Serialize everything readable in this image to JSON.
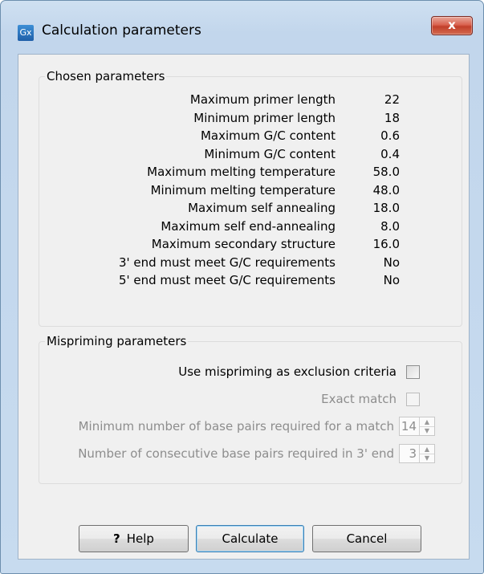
{
  "window": {
    "title": "Calculation parameters",
    "app_icon": "Gx",
    "close_glyph": "x"
  },
  "chosen": {
    "group_label": "Chosen parameters",
    "rows": [
      {
        "label": "Maximum primer length",
        "value": "22"
      },
      {
        "label": "Minimum primer length",
        "value": "18"
      },
      {
        "label": "Maximum G/C content",
        "value": "0.6"
      },
      {
        "label": "Minimum G/C content",
        "value": "0.4"
      },
      {
        "label": "Maximum melting temperature",
        "value": "58.0"
      },
      {
        "label": "Minimum melting temperature",
        "value": "48.0"
      },
      {
        "label": "Maximum self annealing",
        "value": "18.0"
      },
      {
        "label": "Maximum self end-annealing",
        "value": "8.0"
      },
      {
        "label": "Maximum secondary structure",
        "value": "16.0"
      },
      {
        "label": "3' end must meet G/C requirements",
        "value": "No"
      },
      {
        "label": "5' end must meet G/C requirements",
        "value": "No"
      }
    ]
  },
  "mispriming": {
    "group_label": "Mispriming parameters",
    "use_exclusion_label": "Use mispriming as exclusion criteria",
    "use_exclusion_checked": false,
    "exact_match_label": "Exact match",
    "exact_match_checked": false,
    "min_pairs_label": "Minimum number of base pairs required for a match",
    "min_pairs_value": "14",
    "consecutive_label": "Number of consecutive base pairs required in 3' end",
    "consecutive_value": "3"
  },
  "buttons": {
    "help_glyph": "?",
    "help_label": "Help",
    "calculate_label": "Calculate",
    "cancel_label": "Cancel"
  }
}
